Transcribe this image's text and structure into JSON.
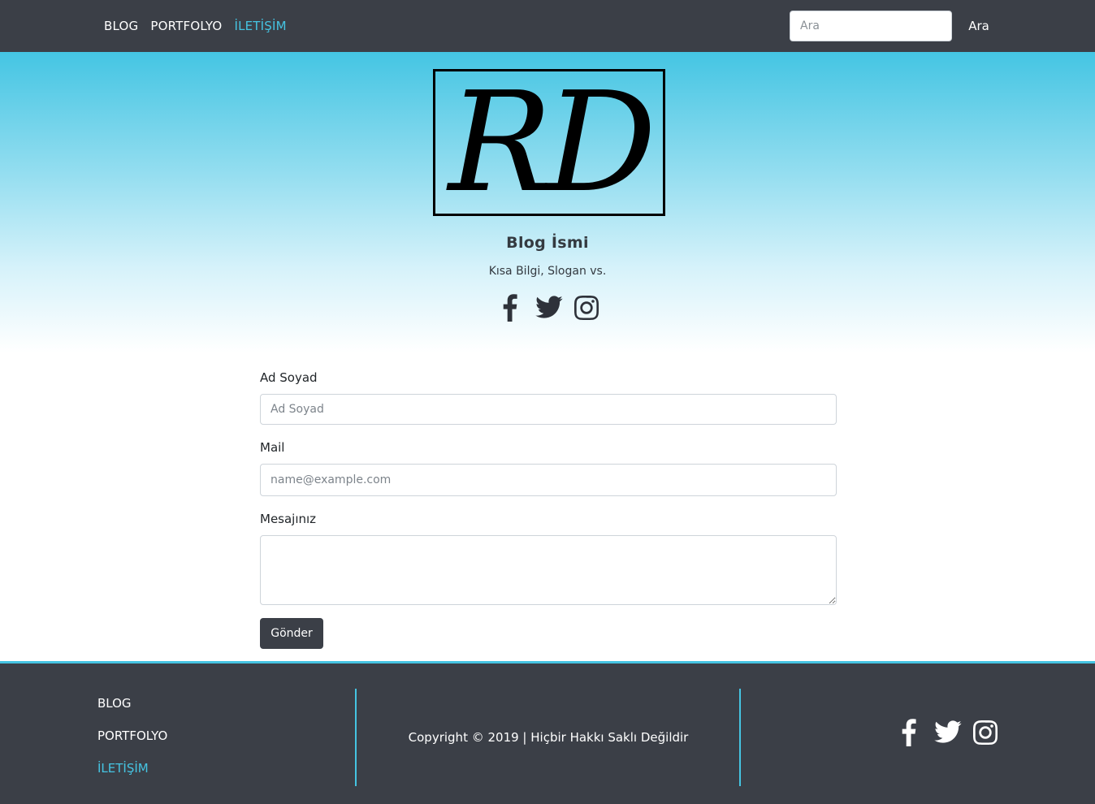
{
  "colors": {
    "dark": "#3b3f47",
    "accent": "#45c4e2",
    "white": "#ffffff"
  },
  "navbar": {
    "links": [
      {
        "label": "BLOG",
        "active": false
      },
      {
        "label": "PORTFOLYO",
        "active": false
      },
      {
        "label": "İLETİŞİM",
        "active": true
      }
    ],
    "search": {
      "placeholder": "Ara",
      "value": "",
      "button_label": "Ara"
    }
  },
  "hero": {
    "logo_text": "RD",
    "title": "Blog İsmi",
    "slogan": "Kısa Bilgi, Slogan vs.",
    "social_icons": [
      "facebook-icon",
      "twitter-icon",
      "instagram-icon"
    ]
  },
  "form": {
    "name": {
      "label": "Ad Soyad",
      "placeholder": "Ad Soyad",
      "value": ""
    },
    "mail": {
      "label": "Mail",
      "placeholder": "name@example.com",
      "value": ""
    },
    "message": {
      "label": "Mesajınız",
      "placeholder": "",
      "value": ""
    },
    "submit_label": "Gönder"
  },
  "footer": {
    "links": [
      {
        "label": "BLOG",
        "active": false
      },
      {
        "label": "PORTFOLYO",
        "active": false
      },
      {
        "label": "İLETİŞİM",
        "active": true
      }
    ],
    "copyright": "Copyright © 2019 | Hiçbir Hakkı Saklı Değildir",
    "social_icons": [
      "facebook-icon",
      "twitter-icon",
      "instagram-icon"
    ]
  }
}
